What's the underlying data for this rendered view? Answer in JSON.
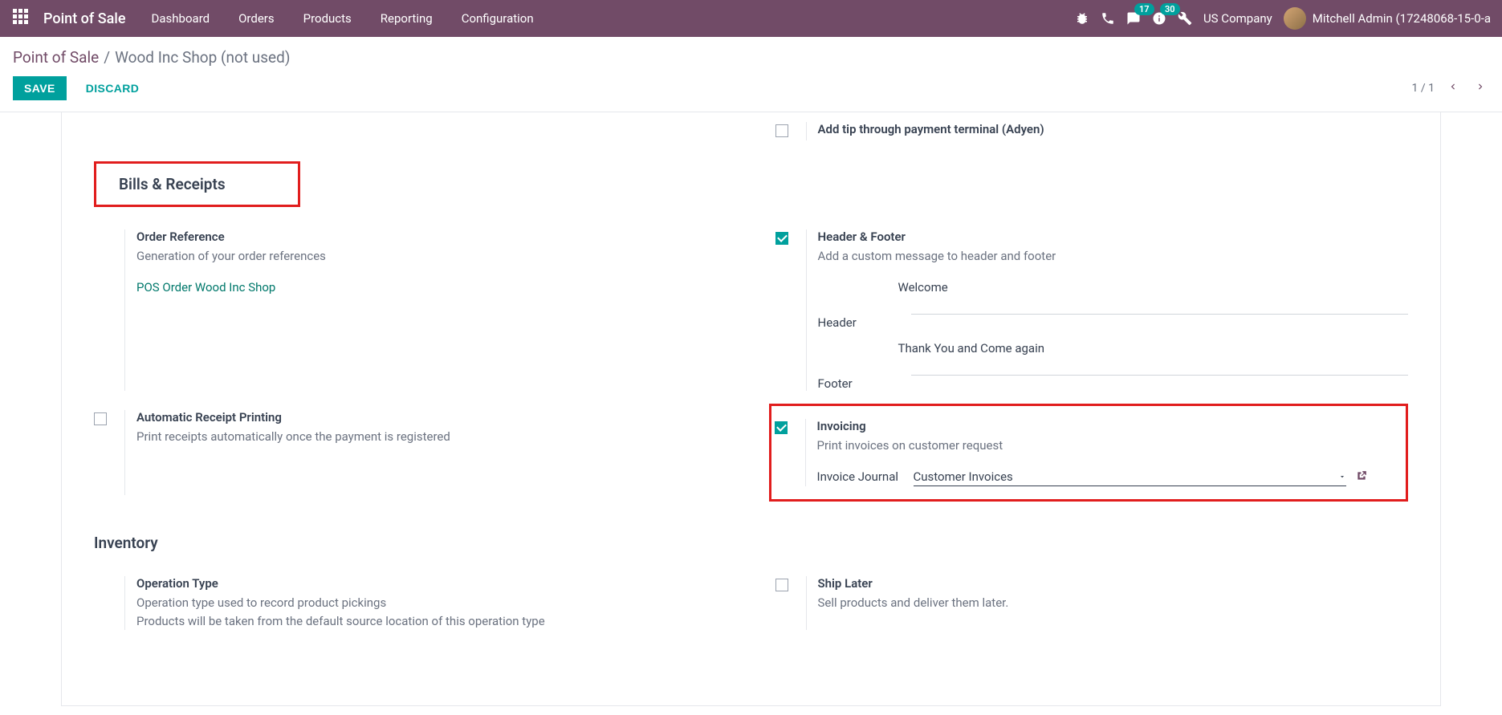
{
  "topbar": {
    "brand": "Point of Sale",
    "nav": [
      "Dashboard",
      "Orders",
      "Products",
      "Reporting",
      "Configuration"
    ],
    "msg_badge": "17",
    "activity_badge": "30",
    "company": "US Company",
    "user": "Mitchell Admin (17248068-15-0-a"
  },
  "crumb": {
    "root": "Point of Sale",
    "sep": "/",
    "current": "Wood Inc Shop (not used)"
  },
  "actions": {
    "save": "SAVE",
    "discard": "DISCARD",
    "pager": "1 / 1"
  },
  "settings": {
    "adyen_tip": {
      "title": "Add tip through payment terminal (Adyen)"
    },
    "section_bills": "Bills & Receipts",
    "order_ref": {
      "title": "Order Reference",
      "desc": "Generation of your order references",
      "link": "POS Order Wood Inc Shop"
    },
    "header_footer": {
      "title": "Header & Footer",
      "desc": "Add a custom message to header and footer",
      "header_value": "Welcome",
      "header_label": "Header",
      "footer_value": "Thank You and Come again",
      "footer_label": "Footer"
    },
    "auto_receipt": {
      "title": "Automatic Receipt Printing",
      "desc": "Print receipts automatically once the payment is registered"
    },
    "invoicing": {
      "title": "Invoicing",
      "desc": "Print invoices on customer request",
      "journal_label": "Invoice Journal",
      "journal_value": "Customer Invoices"
    },
    "section_inventory": "Inventory",
    "op_type": {
      "title": "Operation Type",
      "desc1": "Operation type used to record product pickings",
      "desc2": "Products will be taken from the default source location of this operation type"
    },
    "ship_later": {
      "title": "Ship Later",
      "desc": "Sell products and deliver them later."
    }
  }
}
